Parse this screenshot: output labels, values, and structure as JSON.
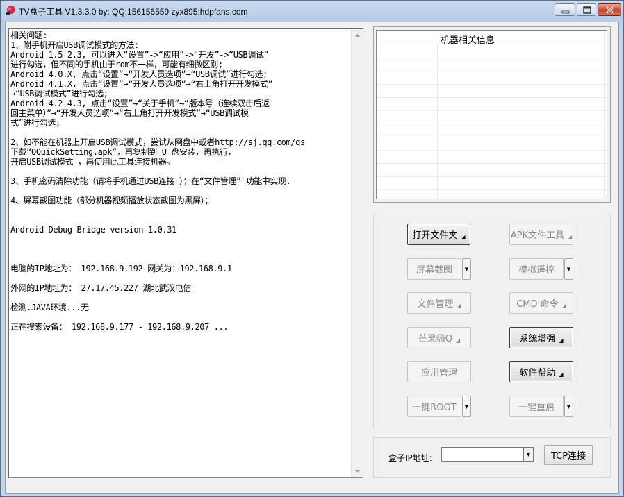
{
  "window": {
    "title": "TV盒子工具 V1.3.3.0 by: QQ:156156559  zyx895:hdpfans.com"
  },
  "log": {
    "lines": [
      "相关问题:",
      "1、附手机开启USB调试模式的方法:",
      "Android 1.5 2.3, 可以进入“设置”->“应用”->“开发”->“USB调试”",
      "进行勾选，但不同的手机由于rom不一样，可能有细微区别;",
      "Android 4.0.X, 点击“设置”→“开发人员选项”→“USB调试”进行勾选;",
      "Android 4.1.X, 点击“设置”→“开发人员选项”→“右上角打开开发模式”",
      "→“USB调试模式”进行勾选;",
      "Android 4.2 4.3, 点击“设置”→“关于手机”→“版本号（连续双击后返",
      "回主菜单）”→“开发人员选项”→“右上角打开开发模式”→“USB调试模",
      "式”进行勾选;",
      "",
      "2、如不能在机器上开启USB调试模式，尝试从网盘中或者http://sj.qq.com/qs",
      "下载“QQuickSetting.apk”，再复制到 U 盘安装，再执行，",
      "开启USB调试模式 ，再使用此工具连接机器。",
      "",
      "3、手机密码清除功能（请将手机通过USB连接 ）；在“文件管理” 功能中实现.",
      "",
      "4、屏幕截图功能（部分机器视频播放状态截图为黑屏）；",
      "",
      "",
      "Android Debug Bridge version 1.0.31",
      "",
      "",
      "",
      "电脑的IP地址为：  192.168.9.192 网关为：192.168.9.1",
      "",
      "外网的IP地址为：  27.17.45.227 湖北武汉电信",
      "",
      "检测.JAVA环境...无",
      "",
      "正在搜索设备：  192.168.9.177 - 192.168.9.207 ..."
    ]
  },
  "info": {
    "header": "机器相关信息"
  },
  "buttons": {
    "open_folder": "打开文件夹",
    "apk_tool": "APK文件工具",
    "screenshot": "屏幕截图",
    "remote": "模拟遥控",
    "file_mgr": "文件管理",
    "cmd": "CMD 命令",
    "mango": "芒果嗨Q",
    "sys_enhance": "系统增强",
    "app_mgr": "应用管理",
    "help": "软件帮助",
    "root": "一键ROOT",
    "reboot": "一键重启"
  },
  "ip": {
    "label": "盒子IP地址:",
    "value": "",
    "tcp_button": "TCP连接"
  },
  "colors": {
    "titlebar": "#c4d6ec",
    "close_button": "#c8452f",
    "client_bg": "#f0f0f0",
    "disabled_text": "#8a8a8a"
  }
}
